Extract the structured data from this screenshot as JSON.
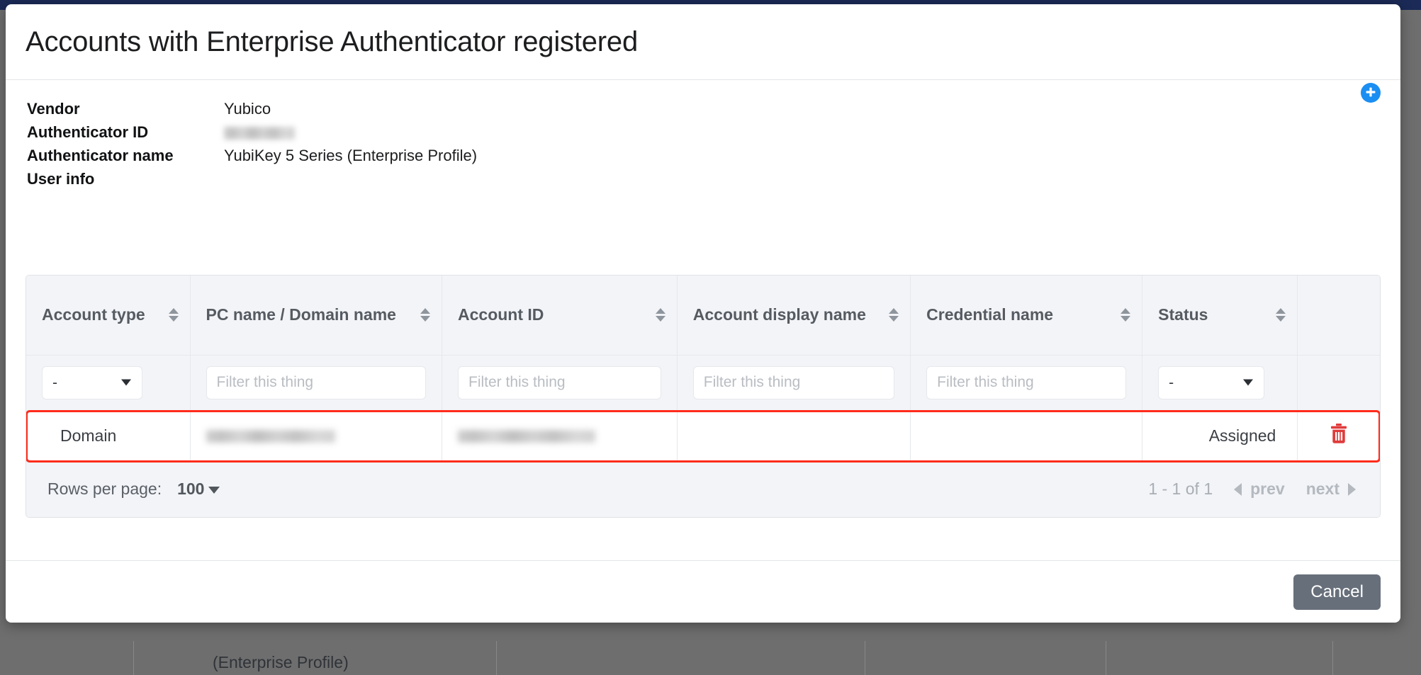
{
  "backdrop": {
    "navbar_color": "#1b2a56",
    "overlay_color": "#6e6e6e",
    "partial_text": "(Enterprise Profile)"
  },
  "modal": {
    "title": "Accounts with Enterprise Authenticator registered",
    "details": [
      {
        "label": "Vendor",
        "value": "Yubico",
        "redacted": false
      },
      {
        "label": "Authenticator ID",
        "value": "",
        "redacted": true
      },
      {
        "label": "Authenticator name",
        "value": "YubiKey 5 Series (Enterprise Profile)",
        "redacted": false
      },
      {
        "label": "User info",
        "value": "",
        "redacted": false
      }
    ],
    "add_row_button": {
      "icon": "plus-circle-icon",
      "color": "#1b8ef2"
    },
    "cancel_label": "Cancel"
  },
  "table": {
    "columns": [
      {
        "key": "account_type",
        "label": "Account type",
        "sortable": true,
        "filter_type": "select"
      },
      {
        "key": "pc_or_domain_name",
        "label": "PC name / Domain name",
        "sortable": true,
        "filter_type": "text"
      },
      {
        "key": "account_id",
        "label": "Account ID",
        "sortable": true,
        "filter_type": "text"
      },
      {
        "key": "account_display_name",
        "label": "Account display name",
        "sortable": true,
        "filter_type": "text"
      },
      {
        "key": "credential_name",
        "label": "Credential name",
        "sortable": true,
        "filter_type": "text"
      },
      {
        "key": "status",
        "label": "Status",
        "sortable": true,
        "filter_type": "select"
      },
      {
        "key": "actions",
        "label": "",
        "sortable": false,
        "filter_type": "none"
      }
    ],
    "filters": {
      "account_type_value": "-",
      "status_value": "-",
      "text_placeholder": "Filter this thing",
      "select_options": [
        "-"
      ]
    },
    "rows": [
      {
        "account_type": "Domain",
        "pc_or_domain_name": "",
        "pc_or_domain_name_redacted": true,
        "account_id": "",
        "account_id_redacted": true,
        "account_display_name": "",
        "credential_name": "",
        "status": "Assigned",
        "delete_icon": "trash-icon",
        "highlighted": true
      }
    ],
    "highlight_color": "#ff2b1c",
    "footer": {
      "rows_per_page_label": "Rows per page:",
      "rows_per_page_value": "100",
      "range_text": "1 - 1 of 1",
      "prev_label": "prev",
      "next_label": "next"
    }
  }
}
